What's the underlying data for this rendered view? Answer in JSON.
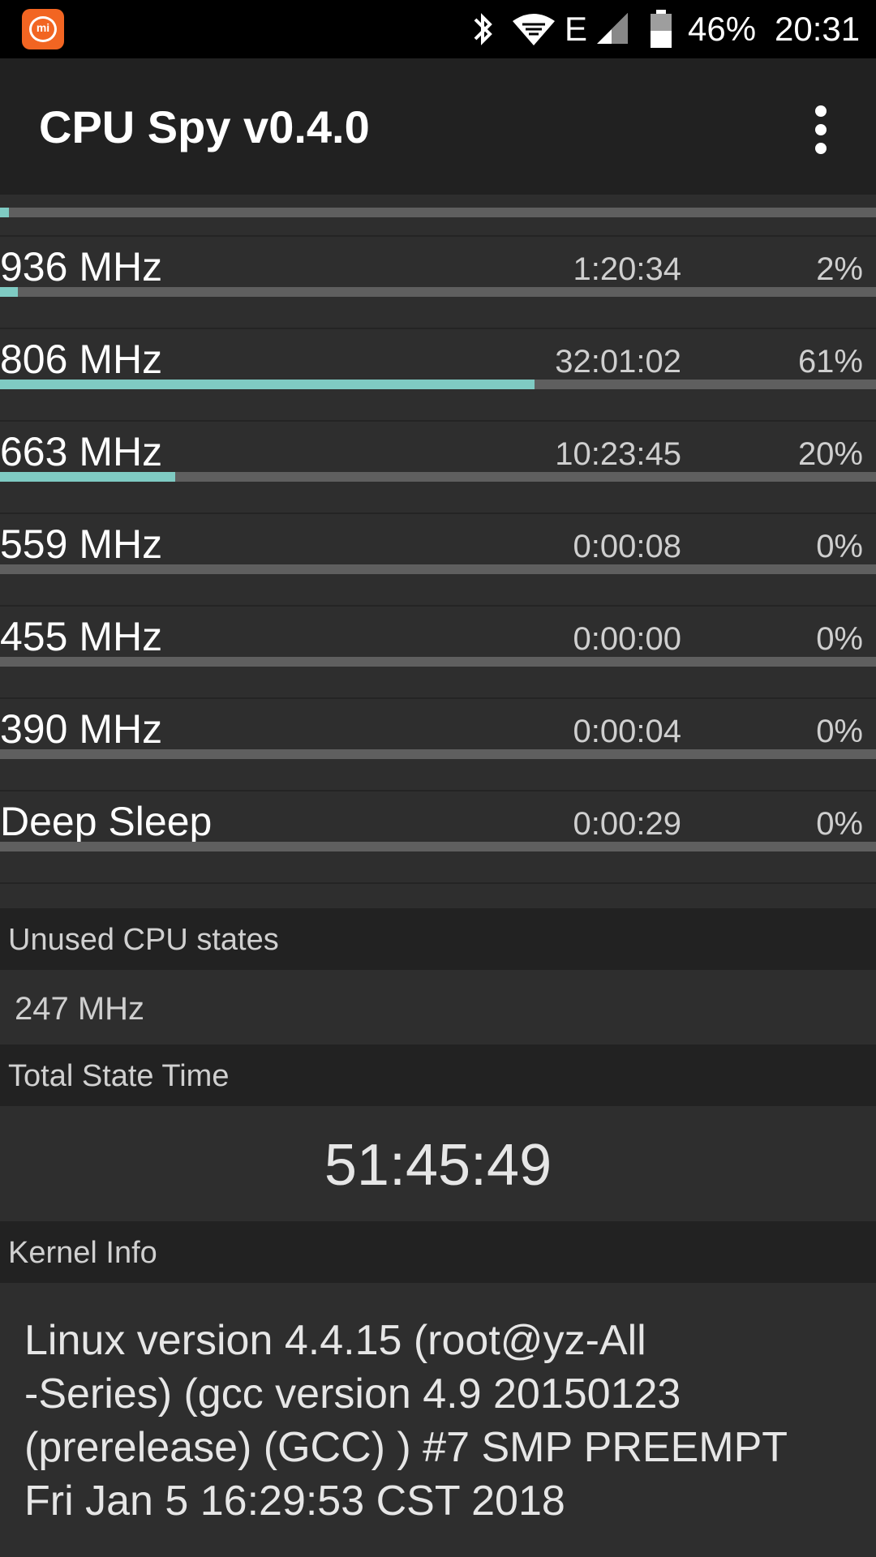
{
  "status_bar": {
    "battery": "46%",
    "time": "20:31",
    "network": "E",
    "icons": [
      "mi-logo",
      "bluetooth-icon",
      "wifi-icon",
      "signal-icon",
      "battery-icon"
    ]
  },
  "app_bar": {
    "title": "CPU Spy v0.4.0",
    "menu_icon": "overflow-menu-icon"
  },
  "colors": {
    "accent": "#7fcbc3",
    "bar_track": "#5f5f5f",
    "background": "#2e2e2e",
    "header_bg": "#222222"
  },
  "top_usage_fraction": 0.01,
  "states": [
    {
      "freq": "936 MHz",
      "time": "1:20:34",
      "pct": "2%",
      "fraction": 0.02
    },
    {
      "freq": "806 MHz",
      "time": "32:01:02",
      "pct": "61%",
      "fraction": 0.61
    },
    {
      "freq": "663 MHz",
      "time": "10:23:45",
      "pct": "20%",
      "fraction": 0.2
    },
    {
      "freq": "559 MHz",
      "time": "0:00:08",
      "pct": "0%",
      "fraction": 0
    },
    {
      "freq": "455 MHz",
      "time": "0:00:00",
      "pct": "0%",
      "fraction": 0
    },
    {
      "freq": "390 MHz",
      "time": "0:00:04",
      "pct": "0%",
      "fraction": 0
    },
    {
      "freq": "Deep Sleep",
      "time": "0:00:29",
      "pct": "0%",
      "fraction": 0
    }
  ],
  "unused": {
    "header": "Unused CPU states",
    "value": "247 MHz"
  },
  "total": {
    "header": "Total State Time",
    "value": "51:45:49"
  },
  "kernel": {
    "header": "Kernel Info",
    "lines": [
      "Linux version 4.4.15 (root@yz-All",
      "-Series) (gcc version 4.9 20150123",
      "(prerelease) (GCC) ) #7 SMP PREEMPT",
      "Fri Jan 5 16:29:53 CST 2018"
    ]
  }
}
